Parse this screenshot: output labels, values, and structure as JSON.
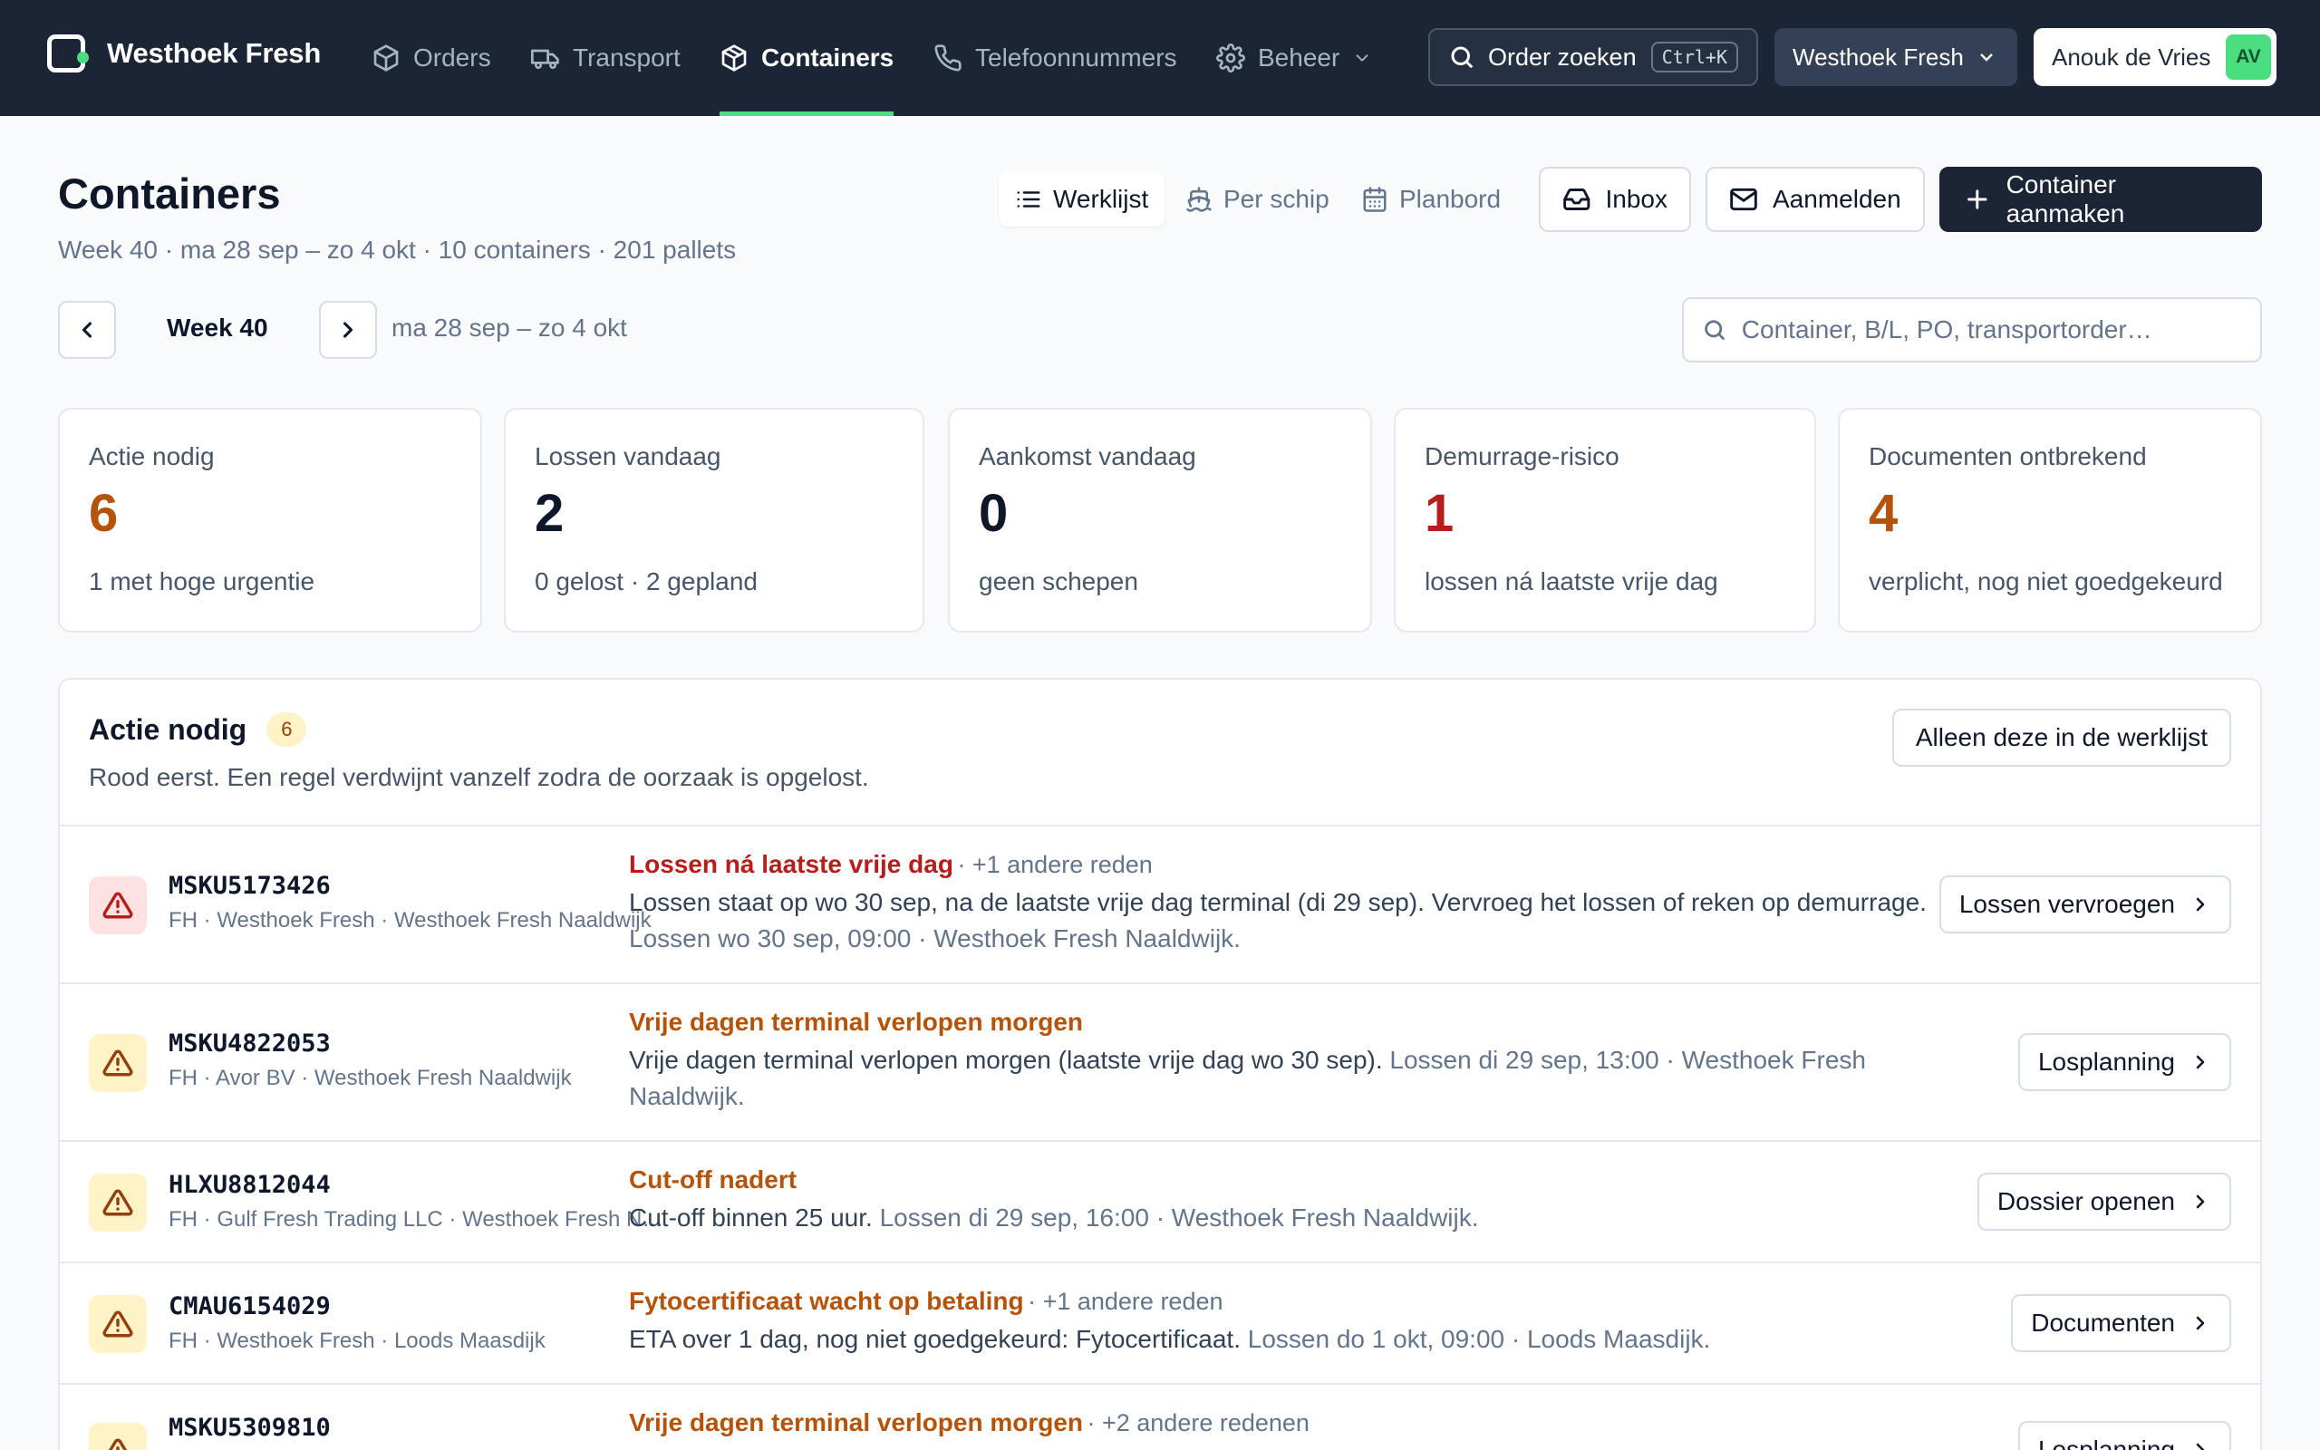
{
  "app": {
    "brand": "Westhoek Fresh"
  },
  "nav": {
    "items": [
      {
        "label": "Orders",
        "icon": "box-icon"
      },
      {
        "label": "Transport",
        "icon": "truck-icon"
      },
      {
        "label": "Containers",
        "icon": "container-icon",
        "active": true
      },
      {
        "label": "Telefoonnummers",
        "icon": "phone-icon"
      },
      {
        "label": "Beheer",
        "icon": "gear-icon"
      }
    ],
    "search_label": "Order zoeken",
    "search_shortcut": "Ctrl+K",
    "company": "Westhoek Fresh",
    "user_name": "Anouk de Vries",
    "user_initials": "AV"
  },
  "page": {
    "title": "Containers",
    "subtitle": "Week 40 · ma 28 sep – zo 4 okt · 10 containers · 201 pallets",
    "views": [
      "Werklijst",
      "Per schip",
      "Planbord"
    ],
    "active_view": "Werklijst",
    "inbox_label": "Inbox",
    "register_label": "Aanmelden",
    "create_label": "Container aanmaken",
    "week_label": "Week 40",
    "week_range": "ma 28 sep – zo 4 okt",
    "search_placeholder": "Container, B/L, PO, transportorder…"
  },
  "stats": [
    {
      "label": "Actie nodig",
      "value": "6",
      "note": "1 met hoge urgentie",
      "color": "#b45309"
    },
    {
      "label": "Lossen vandaag",
      "value": "2",
      "note": "0 gelost · 2 gepland",
      "color": "#0f172a"
    },
    {
      "label": "Aankomst vandaag",
      "value": "0",
      "note": "geen schepen",
      "color": "#0f172a"
    },
    {
      "label": "Demurrage-risico",
      "value": "1",
      "note": "lossen ná laatste vrije dag",
      "color": "#b91c1c"
    },
    {
      "label": "Documenten ontbrekend",
      "value": "4",
      "note": "verplicht, nog niet goedgekeurd",
      "color": "#b45309"
    }
  ],
  "action_panel": {
    "title": "Actie nodig",
    "count": "6",
    "subtitle": "Rood eerst. Een regel verdwijnt vanzelf zodra de oorzaak is opgelost.",
    "filter_label": "Alleen deze in de werklijst",
    "rows": [
      {
        "severity": "red",
        "container": "MSKU5173426",
        "meta": "FH · Westhoek Fresh · Westhoek Fresh Naaldwijk",
        "reason": "Lossen ná laatste vrije dag",
        "extra": "· +1 andere reden",
        "desc": "Lossen staat op wo 30 sep, na de laatste vrije dag terminal (di 29 sep). Vervroeg het lossen of reken op demurrage.",
        "desc_muted": "Lossen wo 30 sep, 09:00 · Westhoek Fresh Naaldwijk.",
        "action": "Lossen vervroegen"
      },
      {
        "severity": "amber",
        "container": "MSKU4822053",
        "meta": "FH · Avor BV · Westhoek Fresh Naaldwijk",
        "reason": "Vrije dagen terminal verlopen morgen",
        "extra": "",
        "desc": "Vrije dagen terminal verlopen morgen (laatste vrije dag wo 30 sep).",
        "desc_muted": "Lossen di 29 sep, 13:00 · Westhoek Fresh Naaldwijk.",
        "action": "Losplanning"
      },
      {
        "severity": "amber",
        "container": "HLXU8812044",
        "meta": "FH · Gulf Fresh Trading LLC · Westhoek Fresh Naaldwijk",
        "reason": "Cut-off nadert",
        "extra": "",
        "desc": "Cut-off binnen 25 uur.",
        "desc_muted": "Lossen di 29 sep, 16:00 · Westhoek Fresh Naaldwijk.",
        "action": "Dossier openen"
      },
      {
        "severity": "amber",
        "container": "CMAU6154029",
        "meta": "FH · Westhoek Fresh · Loods Maasdijk",
        "reason": "Fytocertificaat wacht op betaling",
        "extra": "· +1 andere reden",
        "desc": "ETA over 1 dag, nog niet goedgekeurd: Fytocertificaat.",
        "desc_muted": "Lossen do 1 okt, 09:00 · Loods Maasdijk.",
        "action": "Documenten"
      },
      {
        "severity": "amber",
        "container": "MSKU5309810",
        "meta": "",
        "reason": "Vrije dagen terminal verlopen morgen",
        "extra": "· +2 andere redenen",
        "desc": "",
        "desc_muted": "",
        "action": "Losplanning"
      }
    ]
  }
}
